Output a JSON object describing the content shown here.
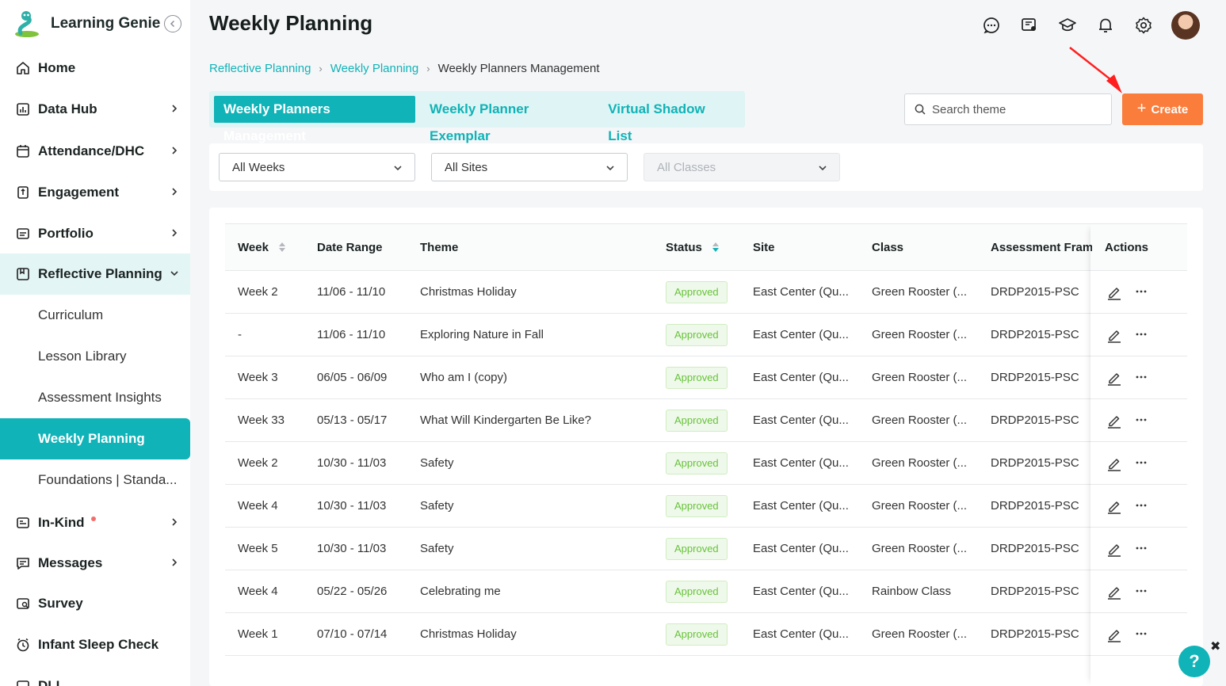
{
  "app": {
    "name": "Learning Genie"
  },
  "sidebar": {
    "items": [
      {
        "label": "Home",
        "icon": "home-icon"
      },
      {
        "label": "Data Hub",
        "icon": "chart-icon"
      },
      {
        "label": "Attendance/DHC",
        "icon": "calendar-icon"
      },
      {
        "label": "Engagement",
        "icon": "engagement-icon"
      },
      {
        "label": "Portfolio",
        "icon": "portfolio-icon"
      },
      {
        "label": "Reflective Planning",
        "icon": "planning-icon"
      },
      {
        "label": "In-Kind",
        "icon": "inkind-icon"
      },
      {
        "label": "Messages",
        "icon": "messages-icon"
      },
      {
        "label": "Survey",
        "icon": "survey-icon"
      },
      {
        "label": "Infant Sleep Check",
        "icon": "clock-icon"
      },
      {
        "label": "DLL",
        "icon": "dll-icon"
      }
    ],
    "subitems": [
      "Curriculum",
      "Lesson Library",
      "Assessment Insights",
      "Weekly Planning",
      "Foundations | Standa..."
    ]
  },
  "header": {
    "title": "Weekly Planning",
    "icons": [
      "chat-icon",
      "contacts-icon",
      "learning-icon",
      "bell-icon",
      "gear-icon"
    ]
  },
  "breadcrumb": [
    "Reflective Planning",
    "Weekly Planning",
    "Weekly Planners Management"
  ],
  "tabs": [
    "Weekly Planners Management",
    "Weekly Planner Exemplar",
    "Virtual Shadow List"
  ],
  "search": {
    "placeholder": "Search theme"
  },
  "create_button": "Create",
  "filters": {
    "weeks": "All Weeks",
    "sites": "All Sites",
    "classes": "All Classes"
  },
  "table": {
    "columns": [
      "Week",
      "Date Range",
      "Theme",
      "Status",
      "Site",
      "Class",
      "Assessment Framework",
      "Actions"
    ],
    "rows": [
      {
        "week": "Week 2",
        "date": "11/06 - 11/10",
        "theme": "Christmas Holiday",
        "status": "Approved",
        "site": "East Center (Qu...",
        "class": "Green Rooster (...",
        "framework": "DRDP2015-PSC"
      },
      {
        "week": "-",
        "date": "11/06 - 11/10",
        "theme": "Exploring Nature in Fall",
        "status": "Approved",
        "site": "East Center (Qu...",
        "class": "Green Rooster (...",
        "framework": "DRDP2015-PSC"
      },
      {
        "week": "Week 3",
        "date": "06/05 - 06/09",
        "theme": "Who am I (copy)",
        "status": "Approved",
        "site": "East Center (Qu...",
        "class": "Green Rooster (...",
        "framework": "DRDP2015-PSC"
      },
      {
        "week": "Week 33",
        "date": "05/13 - 05/17",
        "theme": "What Will Kindergarten Be Like?",
        "status": "Approved",
        "site": "East Center (Qu...",
        "class": "Green Rooster (...",
        "framework": "DRDP2015-PSC"
      },
      {
        "week": "Week 2",
        "date": "10/30 - 11/03",
        "theme": "Safety",
        "status": "Approved",
        "site": "East Center (Qu...",
        "class": "Green Rooster (...",
        "framework": "DRDP2015-PSC"
      },
      {
        "week": "Week 4",
        "date": "10/30 - 11/03",
        "theme": "Safety",
        "status": "Approved",
        "site": "East Center (Qu...",
        "class": "Green Rooster (...",
        "framework": "DRDP2015-PSC"
      },
      {
        "week": "Week 5",
        "date": "10/30 - 11/03",
        "theme": "Safety",
        "status": "Approved",
        "site": "East Center (Qu...",
        "class": "Green Rooster (...",
        "framework": "DRDP2015-PSC"
      },
      {
        "week": "Week 4",
        "date": "05/22 - 05/26",
        "theme": "Celebrating me",
        "status": "Approved",
        "site": "East Center (Qu...",
        "class": "Rainbow Class",
        "framework": "DRDP2015-PSC"
      },
      {
        "week": "Week 1",
        "date": "07/10 - 07/14",
        "theme": "Christmas Holiday",
        "status": "Approved",
        "site": "East Center (Qu...",
        "class": "Green Rooster (...",
        "framework": "DRDP2015-PSC"
      }
    ]
  },
  "help": {
    "label": "?",
    "close": "✖"
  },
  "colors": {
    "accent": "#10b3b7",
    "create": "#fa7d3c",
    "approved": "#67c23a",
    "annotation_arrow": "#ff1f1f"
  }
}
